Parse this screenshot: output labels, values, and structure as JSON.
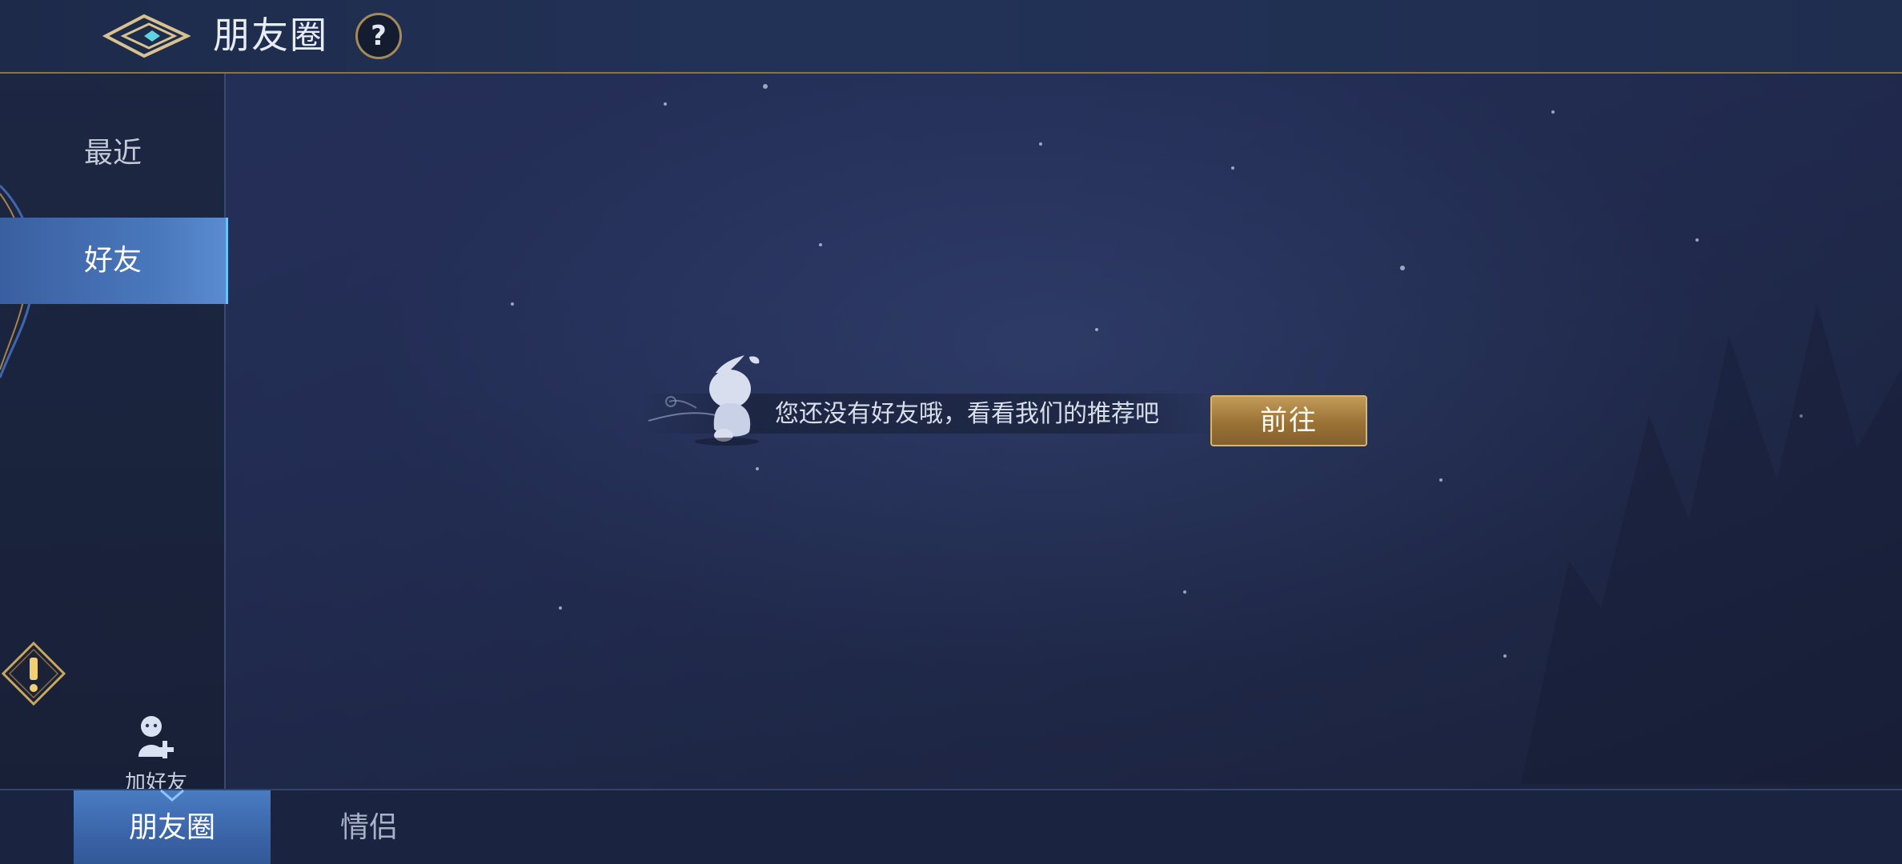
{
  "header": {
    "title": "朋友圈",
    "help_label": "?"
  },
  "sidebar": {
    "items": [
      {
        "label": "最近",
        "selected": false
      },
      {
        "label": "好友",
        "selected": true
      }
    ],
    "add_friend_label": "加好友"
  },
  "main": {
    "empty_message": "您还没有好友哦，看看我们的推荐吧",
    "go_button_label": "前往"
  },
  "bottom_tabs": [
    {
      "label": "朋友圈",
      "selected": true
    },
    {
      "label": "情侣",
      "selected": false
    }
  ],
  "colors": {
    "accent_gold": "#c29a58",
    "selected_tab_blue": "#4a78bd",
    "background_navy": "#222c52"
  }
}
